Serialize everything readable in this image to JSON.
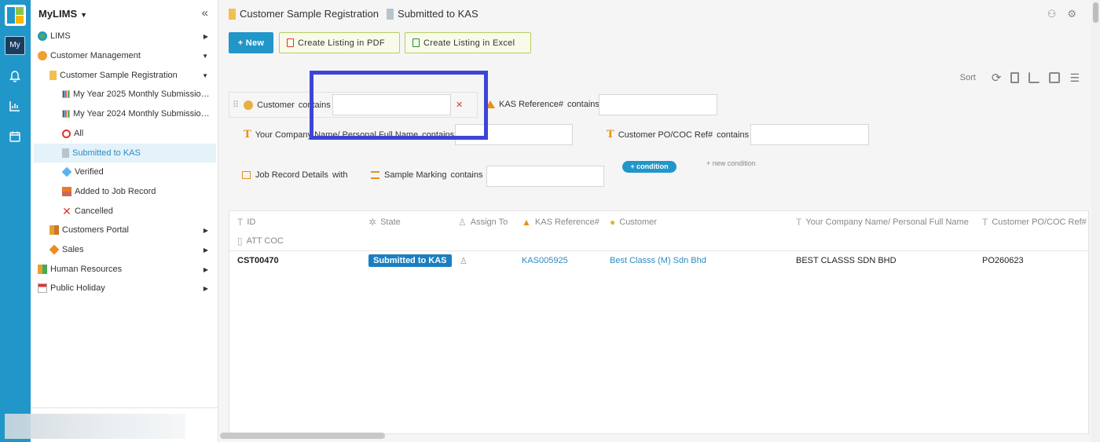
{
  "rail": {
    "my_label": "My"
  },
  "nav": {
    "app_title": "MyLIMS",
    "items": [
      {
        "label": "LIMS"
      },
      {
        "label": "Customer Management"
      },
      {
        "label": "Customer Sample Registration"
      },
      {
        "label": "My Year 2025 Monthly Submission..."
      },
      {
        "label": "My Year 2024 Monthly Submission..."
      },
      {
        "label": "All"
      },
      {
        "label": "Submitted to KAS"
      },
      {
        "label": "Verified"
      },
      {
        "label": "Added to Job Record"
      },
      {
        "label": "Cancelled"
      },
      {
        "label": "Customers Portal"
      },
      {
        "label": "Sales"
      },
      {
        "label": "Human Resources"
      },
      {
        "label": "Public Holiday"
      }
    ]
  },
  "breadcrumb": {
    "first": "Customer Sample Registration",
    "second": "Submitted to KAS"
  },
  "buttons": {
    "new": "+ New",
    "pdf": "Create Listing in PDF",
    "excel": "Create Listing in Excel"
  },
  "toolbar": {
    "sort": "Sort"
  },
  "filters": {
    "customer_label": "Customer",
    "customer_op": "contains",
    "kas_label": "KAS Reference#",
    "kas_op": "contains",
    "company_label": "Your Company Name/ Personal Full Name",
    "company_op": "contains",
    "po_label": "Customer PO/COC Ref#",
    "po_op": "contains",
    "job_label": "Job Record Details",
    "job_op": "with",
    "marking_label": "Sample Marking",
    "marking_op": "contains",
    "add_condition": "+ condition",
    "new_condition": "+ new condition"
  },
  "table": {
    "headers": [
      "ID",
      "State",
      "Assign To",
      "KAS Reference#",
      "Customer",
      "Your Company Name/ Personal Full Name",
      "Customer PO/COC Ref#",
      "ATT COC"
    ],
    "rows": [
      {
        "id": "CST00470",
        "state": "Submitted to KAS",
        "kas": "KAS005925",
        "customer": "Best Classs (M) Sdn Bhd",
        "company": "BEST CLASSS SDN BHD",
        "po": "PO260623"
      }
    ]
  },
  "colors": {
    "accent": "#2196c9",
    "focus": "#3d45d8",
    "badge": "#1a7fc1"
  }
}
